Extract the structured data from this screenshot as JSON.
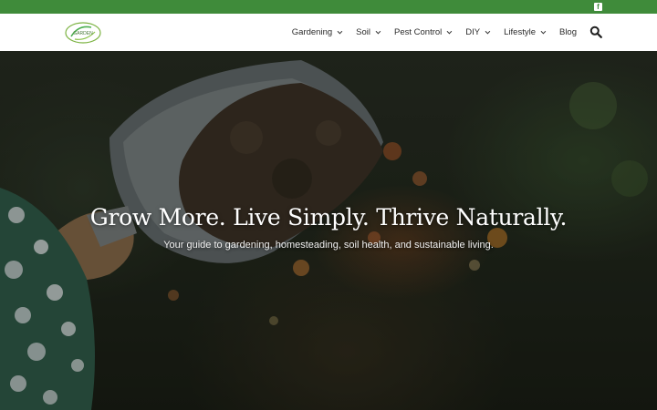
{
  "topbar": {
    "social_icon": "facebook-square-icon",
    "social_letter": "f",
    "color": "#3f8b3a"
  },
  "header": {
    "logo_text": "GARDEN",
    "nav": [
      {
        "label": "Gardening",
        "dropdown": true
      },
      {
        "label": "Soil",
        "dropdown": true
      },
      {
        "label": "Pest Control",
        "dropdown": true
      },
      {
        "label": "DIY",
        "dropdown": true
      },
      {
        "label": "Lifestyle",
        "dropdown": true
      },
      {
        "label": "Blog",
        "dropdown": false
      }
    ],
    "search_icon": "search-icon"
  },
  "hero": {
    "title": "Grow More. Live Simply. Thrive Naturally.",
    "subtitle": "Your guide to gardening, homesteading, soil health, and sustainable living."
  }
}
